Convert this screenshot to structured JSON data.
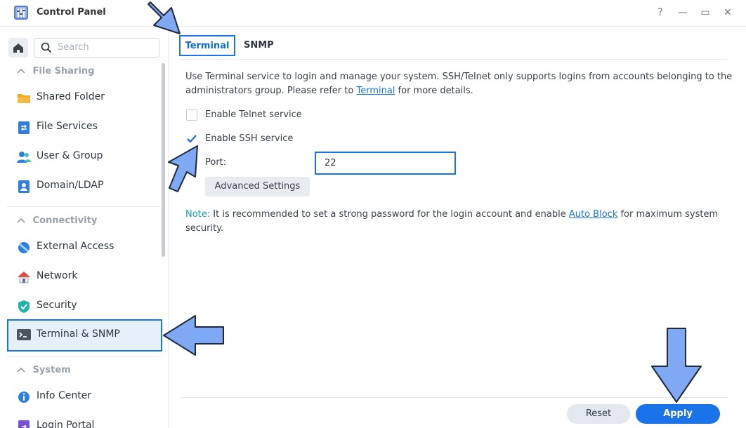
{
  "window": {
    "title": "Control Panel",
    "help_glyph": "?",
    "minimize_glyph": "—",
    "maximize_glyph": "▭",
    "close_glyph": "✕"
  },
  "sidebar": {
    "search_placeholder": "Search",
    "sections": [
      {
        "label": "File Sharing",
        "items": [
          {
            "label": "Shared Folder",
            "icon": "shared-folder-icon"
          },
          {
            "label": "File Services",
            "icon": "file-services-icon"
          },
          {
            "label": "User & Group",
            "icon": "user-group-icon"
          },
          {
            "label": "Domain/LDAP",
            "icon": "domain-ldap-icon"
          }
        ]
      },
      {
        "label": "Connectivity",
        "items": [
          {
            "label": "External Access",
            "icon": "external-access-icon"
          },
          {
            "label": "Network",
            "icon": "network-icon"
          },
          {
            "label": "Security",
            "icon": "security-shield-icon"
          },
          {
            "label": "Terminal & SNMP",
            "icon": "terminal-icon",
            "active": true
          }
        ]
      },
      {
        "label": "System",
        "items": [
          {
            "label": "Info Center",
            "icon": "info-icon"
          },
          {
            "label": "Login Portal",
            "icon": "login-portal-icon"
          }
        ]
      }
    ]
  },
  "tabs": [
    {
      "label": "Terminal",
      "active": true
    },
    {
      "label": "SNMP",
      "active": false
    }
  ],
  "content": {
    "description_part1": "Use Terminal service to login and manage your system. SSH/Telnet only supports logins from accounts belonging to the administrators group. Please refer to ",
    "description_link": "Terminal",
    "description_part2": " for more details.",
    "telnet_label": "Enable Telnet service",
    "telnet_checked": false,
    "ssh_label": "Enable SSH service",
    "ssh_checked": true,
    "port_label": "Port:",
    "port_value": "22",
    "advanced_button": "Advanced Settings",
    "note_label": "Note:",
    "note_part1": " It is recommended to set a strong password for the login account and enable ",
    "note_link": "Auto Block",
    "note_part2": " for maximum system security."
  },
  "footer": {
    "reset_label": "Reset",
    "apply_label": "Apply"
  },
  "colors": {
    "accent": "#1a73e8",
    "annotation_arrow": "#7fa9f5",
    "note_label": "#17a2a0"
  }
}
